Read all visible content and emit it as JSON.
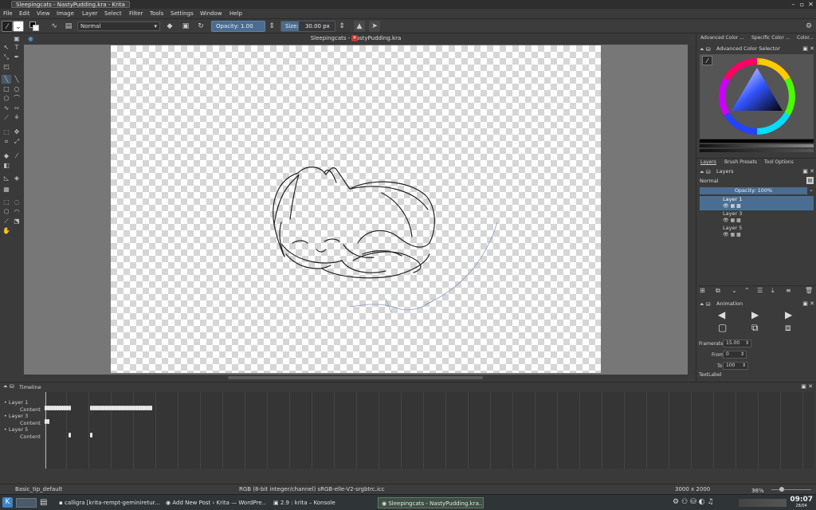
{
  "window": {
    "title": "Sleepingcats - NastyPudding.kra - Krita"
  },
  "menu": [
    "File",
    "Edit",
    "View",
    "Image",
    "Layer",
    "Select",
    "Filter",
    "Tools",
    "Settings",
    "Window",
    "Help"
  ],
  "toolbar": {
    "blend_mode": "Normal",
    "opacity": "Opacity:  1.00",
    "size_label": "Size:",
    "size_value": "30.00 px"
  },
  "document": {
    "tab_title": "Sleepingcats - NastyPudding.kra"
  },
  "dock": {
    "top_tabs": [
      "Advanced Color ...",
      "Specific Color ...",
      "Color..."
    ],
    "color_selector_title": "Advanced Color Selector",
    "mid_tabs": [
      "Layers",
      "Brush Presets",
      "Tool Options"
    ],
    "layers_title": "Layers",
    "blend_mode": "Normal",
    "opacity": "Opacity:  100%",
    "layers": [
      {
        "name": "Layer 1",
        "selected": true
      },
      {
        "name": "Layer 3",
        "selected": false
      },
      {
        "name": "Layer 5",
        "selected": false
      }
    ],
    "animation_title": "Animation",
    "framerate_label": "Framerate",
    "framerate_value": "15.00",
    "from_label": "From",
    "from_value": "0",
    "to_label": "To",
    "to_value": "100",
    "text_label": "TextLabel"
  },
  "timeline": {
    "title": "Timeline",
    "rows": [
      {
        "layer": "Layer 1",
        "channel": "Content"
      },
      {
        "layer": "Layer 3",
        "channel": "Content"
      },
      {
        "layer": "Layer 5",
        "channel": "Content"
      }
    ]
  },
  "status": {
    "brush": "Basic_tip_default",
    "color_info": "RGB (8-bit integer/channel)   sRGB-elle-V2-srgbtrc.icc",
    "dimensions": "3000 x 2000",
    "zoom": "38%"
  },
  "taskbar": {
    "tasks": [
      {
        "label": "calligra [krita-rempt-geminiretur...",
        "active": false
      },
      {
        "label": "Add New Post ‹ Krita — WordPre...",
        "active": false
      },
      {
        "label": "2.9 : krita – Konsole",
        "active": false
      },
      {
        "label": "Sleepingcats - NastyPudding.kra...",
        "active": true
      }
    ],
    "time": "09:07",
    "date": "28/04"
  }
}
